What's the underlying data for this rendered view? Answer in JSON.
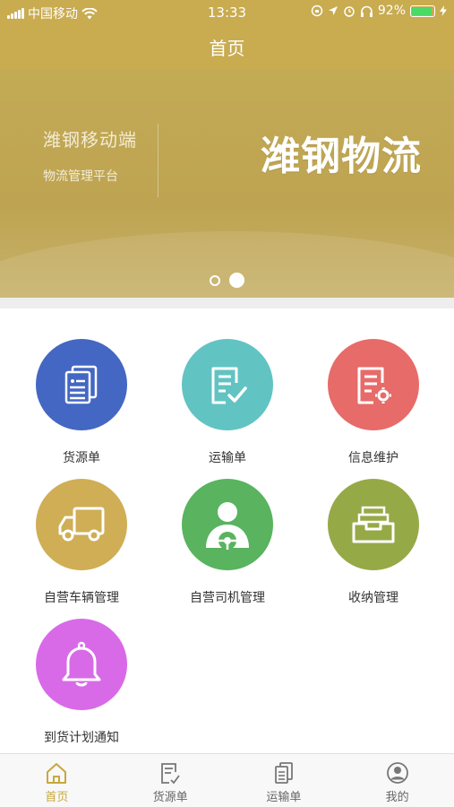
{
  "status_bar": {
    "carrier": "中国移动",
    "time": "13:33",
    "battery": "92%",
    "battery_level": 0.92
  },
  "nav": {
    "title": "首页"
  },
  "banner": {
    "subtitle1": "潍钢移动端",
    "subtitle2": "物流管理平台",
    "headline": "潍钢物流",
    "active_slide": 2,
    "slide_count": 2
  },
  "grid": [
    {
      "label": "货源单",
      "icon": "documents-icon",
      "color": "#4467c3"
    },
    {
      "label": "运输单",
      "icon": "document-check-icon",
      "color": "#62c3c3"
    },
    {
      "label": "信息维护",
      "icon": "document-gear-icon",
      "color": "#e76b69"
    },
    {
      "label": "自营车辆管理",
      "icon": "truck-icon",
      "color": "#cfae55"
    },
    {
      "label": "自营司机管理",
      "icon": "driver-icon",
      "color": "#59b35f"
    },
    {
      "label": "收纳管理",
      "icon": "inbox-tray-icon",
      "color": "#96a947"
    },
    {
      "label": "到货计划通知",
      "icon": "bell-icon",
      "color": "#d86ae8"
    }
  ],
  "tabs": [
    {
      "label": "首页",
      "icon": "home-icon",
      "active": true
    },
    {
      "label": "货源单",
      "icon": "document-edit-icon",
      "active": false
    },
    {
      "label": "运输单",
      "icon": "documents-icon",
      "active": false
    },
    {
      "label": "我的",
      "icon": "user-icon",
      "active": false
    }
  ],
  "colors": {
    "brand": "#c9ab50",
    "tab_active": "#c9a83a"
  }
}
